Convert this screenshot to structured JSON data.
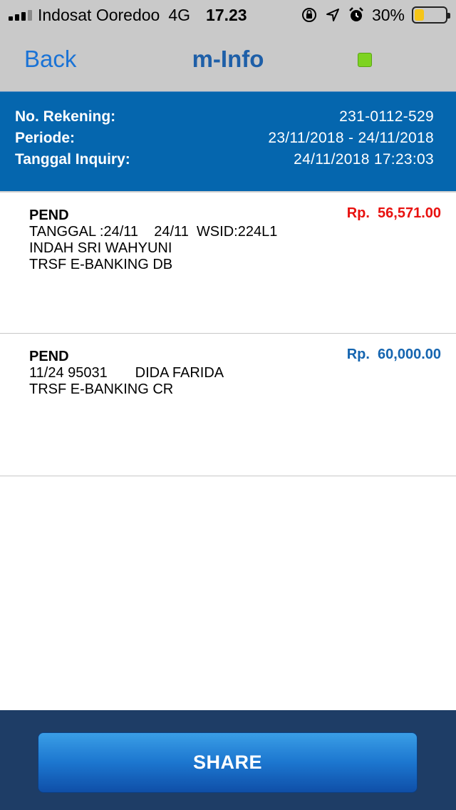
{
  "status_bar": {
    "carrier": "Indosat Ooredoo",
    "network": "4G",
    "time": "17.23",
    "battery_percent": "30%",
    "battery_level": 0.3,
    "icons": [
      "signal-icon",
      "orientation-lock-icon",
      "location-icon",
      "alarm-icon",
      "battery-icon"
    ]
  },
  "nav": {
    "back_label": "Back",
    "title": "m-Info",
    "indicator_color": "#7dd321"
  },
  "account": {
    "rekening_label": "No. Rekening:",
    "rekening_value": "231-0112-529",
    "periode_label": "Periode:",
    "periode_value": "23/11/2018 - 24/11/2018",
    "inquiry_label": "Tanggal Inquiry:",
    "inquiry_value": "24/11/2018 17:23:03"
  },
  "transactions": [
    {
      "status": "PEND",
      "line1": "TANGGAL :24/11    24/11  WSID:224L1",
      "line2": "INDAH SRI WAHYUNI",
      "line3": "TRSF E-BANKING DB",
      "amount": "Rp.  56,571.00",
      "amount_color": "#e8110f"
    },
    {
      "status": "PEND",
      "line1": "11/24 95031       DIDA FARIDA",
      "line2": "TRSF E-BANKING CR",
      "line3": "",
      "amount": "Rp.  60,000.00",
      "amount_color": "#1565b0"
    }
  ],
  "share": {
    "label": "SHARE"
  },
  "colors": {
    "header_bg": "#c9c9c9",
    "info_bg": "#0566ae",
    "bottom_bg": "#1e3d66",
    "debit": "#e8110f",
    "credit": "#1565b0"
  }
}
